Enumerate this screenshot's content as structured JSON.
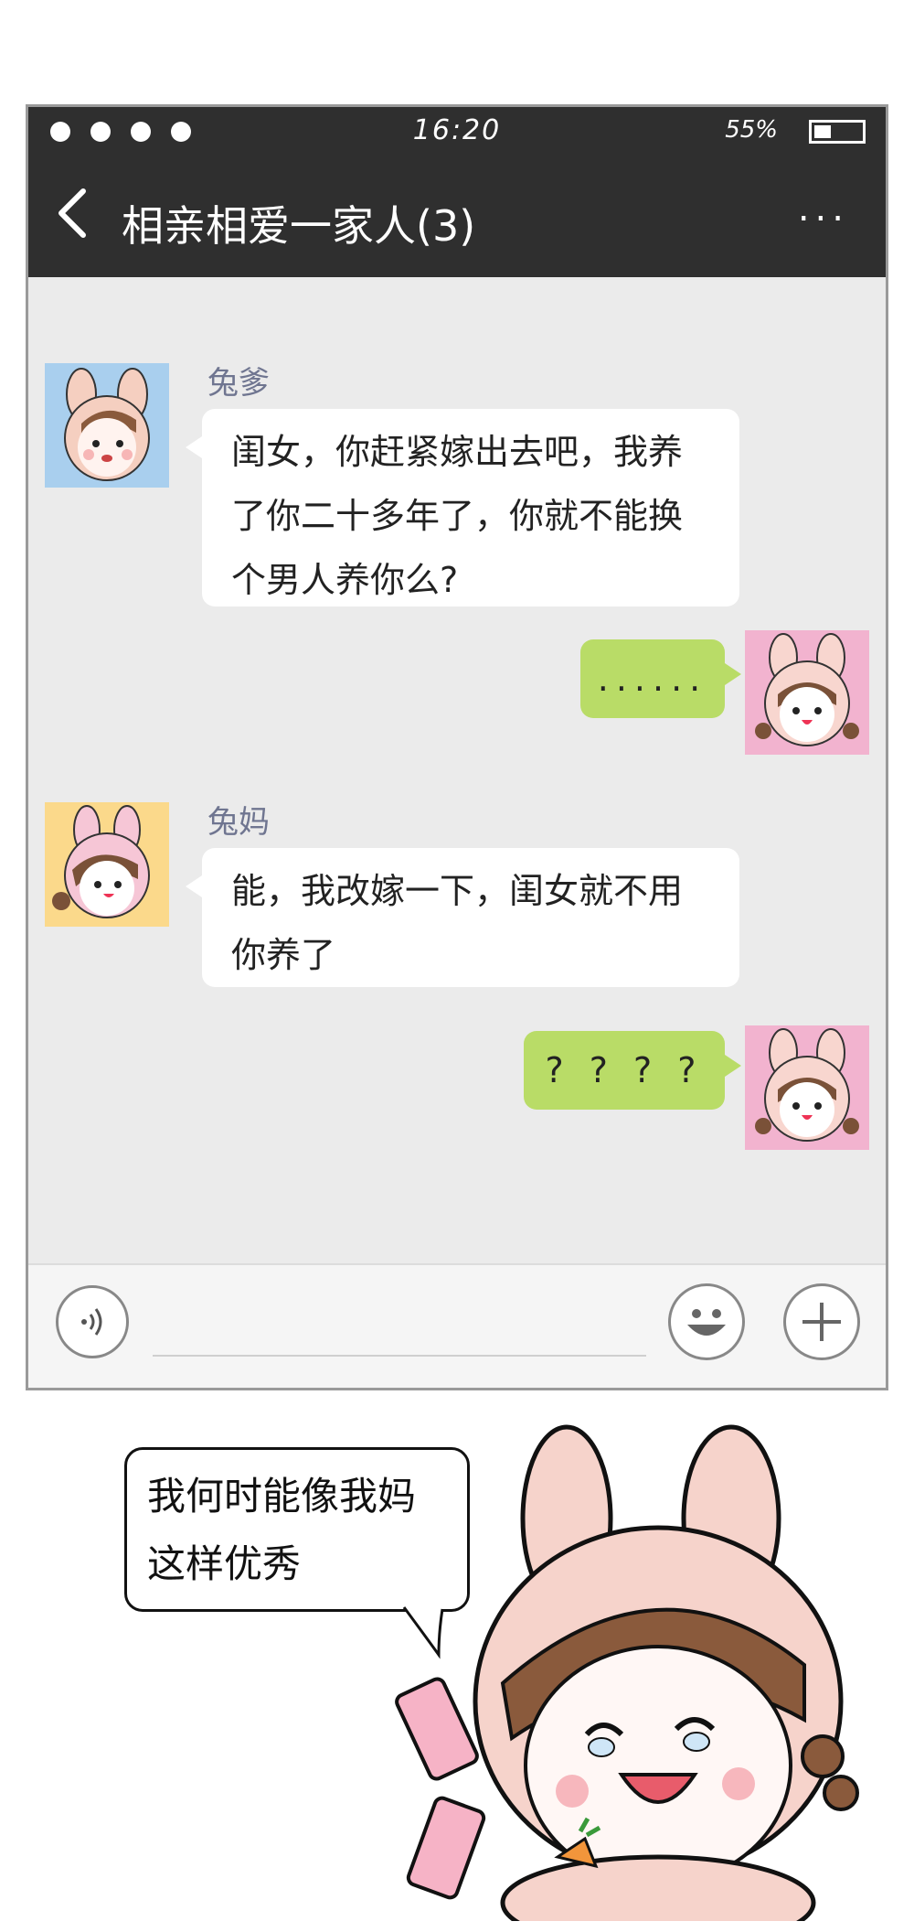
{
  "status": {
    "time": "16:20",
    "battery": "55%"
  },
  "header": {
    "title": "相亲相爱一家人(3)",
    "back_icon": "chevron-left-icon",
    "more_label": "..."
  },
  "messages": [
    {
      "sender": "兔爹",
      "side": "left",
      "text_lines": [
        "闺女，你赶紧嫁出去吧，我养",
        "了你二十多年了，你就不能换",
        "个男人养你么?"
      ]
    },
    {
      "sender": "",
      "side": "right",
      "text": "......"
    },
    {
      "sender": "兔妈",
      "side": "left",
      "text_lines": [
        "能，我改嫁一下，闺女就不用",
        "你养了"
      ]
    },
    {
      "sender": "",
      "side": "right",
      "text": "? ? ? ?"
    }
  ],
  "input_bar": {
    "voice_icon": "voice-icon",
    "emoji_icon": "smile-icon",
    "add_icon": "plus-icon"
  },
  "caption": {
    "lines": [
      "我何时能像我妈",
      "这样优秀"
    ]
  },
  "colors": {
    "header_bg": "#2f2f2f",
    "chat_bg": "#ebebeb",
    "bubble_green": "#b9dc67",
    "name_color": "#6f7590"
  }
}
